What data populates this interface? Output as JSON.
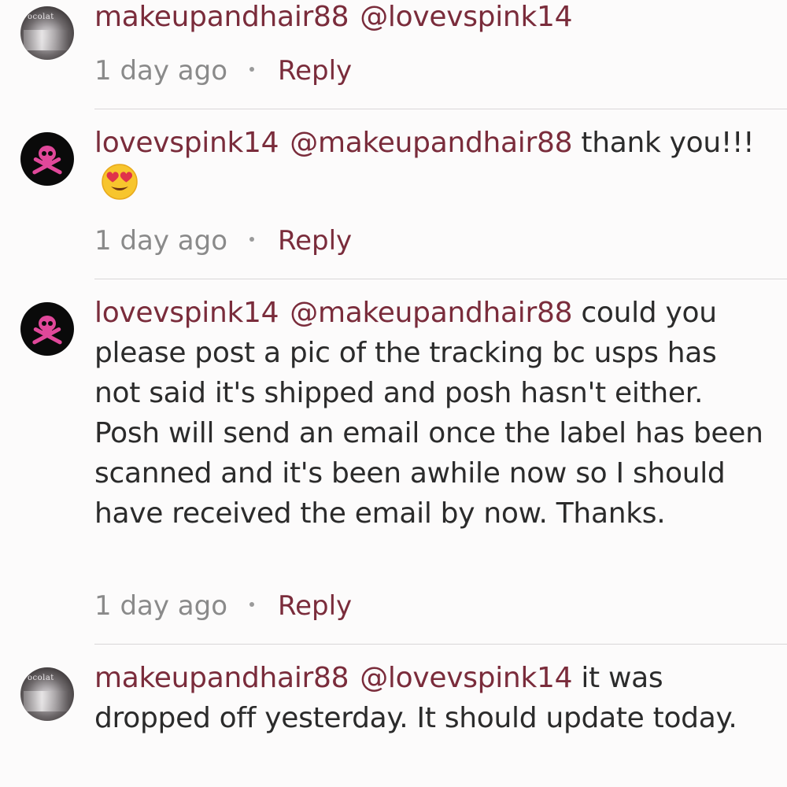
{
  "comments": [
    {
      "username": "makeupandhair88",
      "mention": "@lovevspink14",
      "text": "",
      "time": "1 day ago",
      "reply_label": "Reply",
      "avatar": "photo-avatar"
    },
    {
      "username": "lovevspink14",
      "mention": "@makeupandhair88",
      "text": "thank you!!!",
      "emoji": "heart-eyes-emoji",
      "time": "1 day ago",
      "reply_label": "Reply",
      "avatar": "pink-skull-avatar"
    },
    {
      "username": "lovevspink14",
      "mention": "@makeupandhair88",
      "text": "could you please post a pic of the tracking bc usps has not said it's shipped and posh hasn't either. Posh will send an email once the label has been scanned and it's been awhile now so I should have received the email by now. Thanks.",
      "time": "1 day ago",
      "reply_label": "Reply",
      "avatar": "pink-skull-avatar"
    },
    {
      "username": "makeupandhair88",
      "mention": "@lovevspink14",
      "text": "it was dropped off yesterday. It should update today.",
      "time": "",
      "reply_label": "",
      "avatar": "photo-avatar"
    }
  ],
  "colors": {
    "username": "#7a2c3b",
    "text": "#2b2b2b",
    "meta": "#8a8a8a",
    "background": "#fcfbfb",
    "skull": "#e0489a"
  }
}
